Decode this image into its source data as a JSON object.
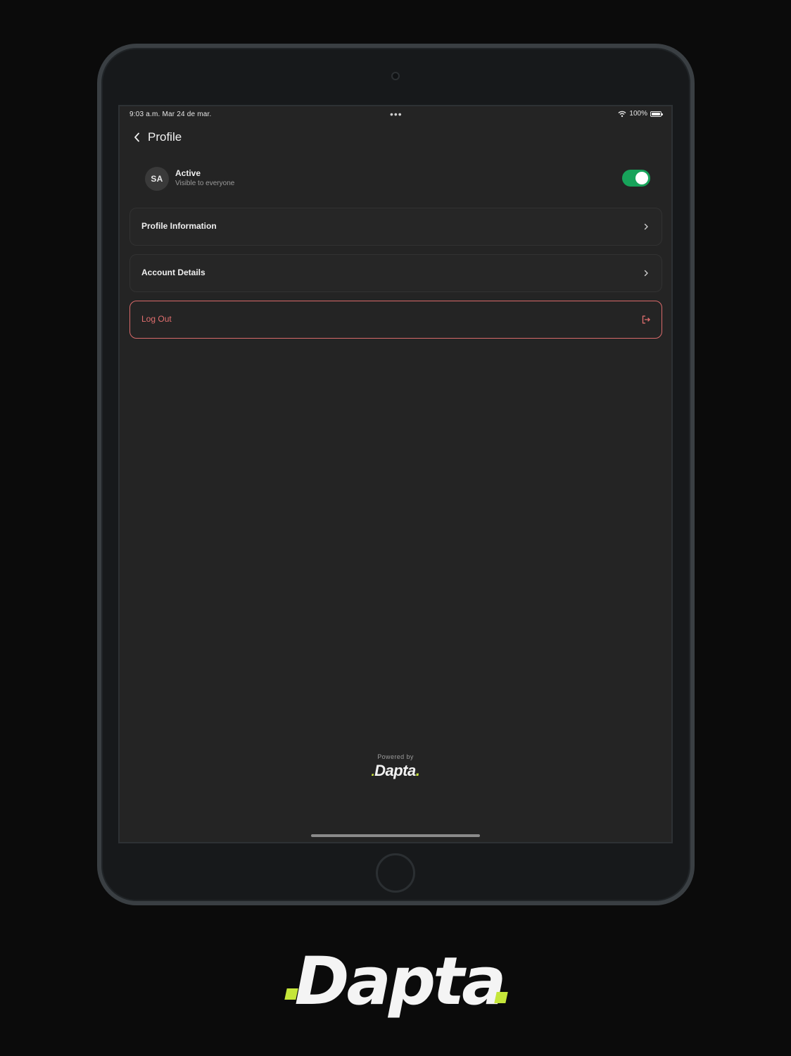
{
  "status_bar": {
    "time_date": "9:03 a.m.   Mar 24 de mar.",
    "dots": "•••",
    "battery_text": "100%"
  },
  "header": {
    "title": "Profile",
    "back_icon": "chevron-left-icon"
  },
  "user_status": {
    "avatar_initials": "SA",
    "title": "Active",
    "subtitle": "Visible to everyone",
    "toggle_on": true,
    "toggle_color": "#17a35a"
  },
  "menu": {
    "profile_information": "Profile Information",
    "account_details": "Account Details",
    "log_out": "Log Out"
  },
  "footer": {
    "powered_by": "Powered by",
    "logo_text": "Dapta"
  },
  "brand": {
    "logo_text": "Dapta",
    "accent_color": "#c5e63a"
  },
  "colors": {
    "background": "#0b0b0b",
    "screen": "#242424",
    "logout_red": "#e26f6f"
  }
}
